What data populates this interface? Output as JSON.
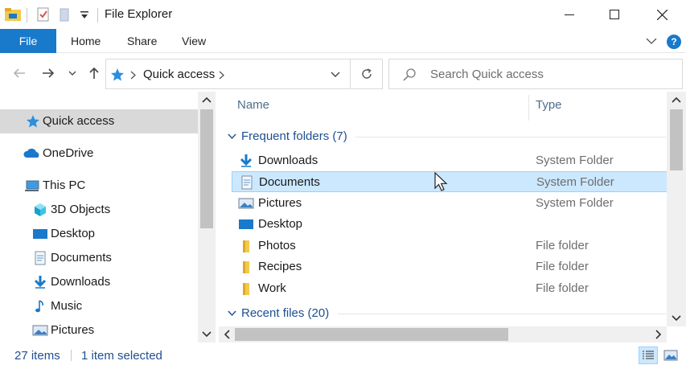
{
  "window": {
    "title": "File Explorer",
    "quick_access_toolbar": [
      "folder-icon",
      "properties-checkbox-icon",
      "new-folder-icon",
      "customize-dropdown-icon"
    ],
    "controls": [
      "minimize-icon",
      "maximize-icon",
      "close-icon"
    ]
  },
  "ribbon": {
    "tabs": [
      "File",
      "Home",
      "Share",
      "View"
    ],
    "help_label": "?"
  },
  "address": {
    "location": "Quick access",
    "search_placeholder": "Search Quick access"
  },
  "nav_pane": {
    "items": [
      {
        "label": "Quick access",
        "icon": "star-icon",
        "selected": true
      },
      {
        "label": "OneDrive",
        "icon": "cloud-icon",
        "selected": false
      },
      {
        "label": "This PC",
        "icon": "computer-icon",
        "selected": false
      },
      {
        "label": "3D Objects",
        "icon": "cube-icon",
        "selected": false
      },
      {
        "label": "Desktop",
        "icon": "desktop-icon",
        "selected": false
      },
      {
        "label": "Documents",
        "icon": "document-icon",
        "selected": false
      },
      {
        "label": "Downloads",
        "icon": "download-icon",
        "selected": false
      },
      {
        "label": "Music",
        "icon": "music-icon",
        "selected": false
      },
      {
        "label": "Pictures",
        "icon": "picture-icon",
        "selected": false
      }
    ]
  },
  "content": {
    "columns": {
      "name": "Name",
      "type": "Type"
    },
    "groups": [
      {
        "label": "Frequent folders (7)"
      },
      {
        "label": "Recent files (20)"
      }
    ],
    "rows": [
      {
        "name": "Downloads",
        "type": "System Folder",
        "icon": "download-icon",
        "selected": false
      },
      {
        "name": "Documents",
        "type": "System Folder",
        "icon": "document-icon",
        "selected": true
      },
      {
        "name": "Pictures",
        "type": "System Folder",
        "icon": "picture-icon",
        "selected": false
      },
      {
        "name": "Desktop",
        "type": "",
        "icon": "desktop-icon",
        "selected": false
      },
      {
        "name": "Photos",
        "type": "File folder",
        "icon": "folder-icon",
        "selected": false
      },
      {
        "name": "Recipes",
        "type": "File folder",
        "icon": "folder-icon",
        "selected": false
      },
      {
        "name": "Work",
        "type": "File folder",
        "icon": "folder-icon",
        "selected": false
      }
    ]
  },
  "status": {
    "item_count": "27 items",
    "selection": "1 item selected"
  },
  "colors": {
    "accent": "#1979ca",
    "selection": "#cce8ff",
    "nav_selected": "#d9d9d9",
    "group_header": "#1e4f91",
    "folder": "#f2c94c"
  }
}
